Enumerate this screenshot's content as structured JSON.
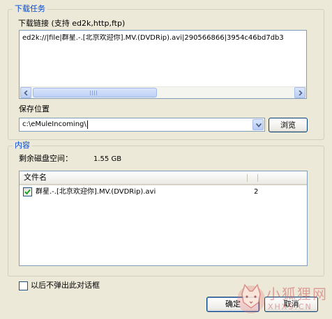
{
  "download_group": {
    "title": "下载任务",
    "link_label": "下载链接 (支持 ed2k,http,ftp)",
    "link_value": "ed2k://|file|群星.-.[北京欢迎你].MV.(DVDRip).avi|290566866|3954c46bd7db3",
    "save_label": "保存位置",
    "save_path": "c:\\eMuleIncoming\\",
    "browse_label": "浏览"
  },
  "content_group": {
    "title": "内容",
    "free_space_label": "剩余磁盘空间：",
    "free_space_value": "1.55 GB",
    "columns": [
      "文件名",
      "",
      ""
    ],
    "rows": [
      {
        "checked": true,
        "name": "群星.-.[北京欢迎你].MV.(DVDRip).avi",
        "size": "2"
      }
    ]
  },
  "footer": {
    "dont_show_label": "以后不弹出此对话框",
    "dont_show_checked": false,
    "ok_label": "确定",
    "cancel_label": "取消"
  },
  "watermark": {
    "text": "小狐狸网",
    "subtext": "XHXS.CN"
  },
  "colors": {
    "group_title": "#0046d5",
    "dialog_bg": "#ece9d8",
    "border_blue": "#7f9db9",
    "check_green": "#21a121"
  }
}
